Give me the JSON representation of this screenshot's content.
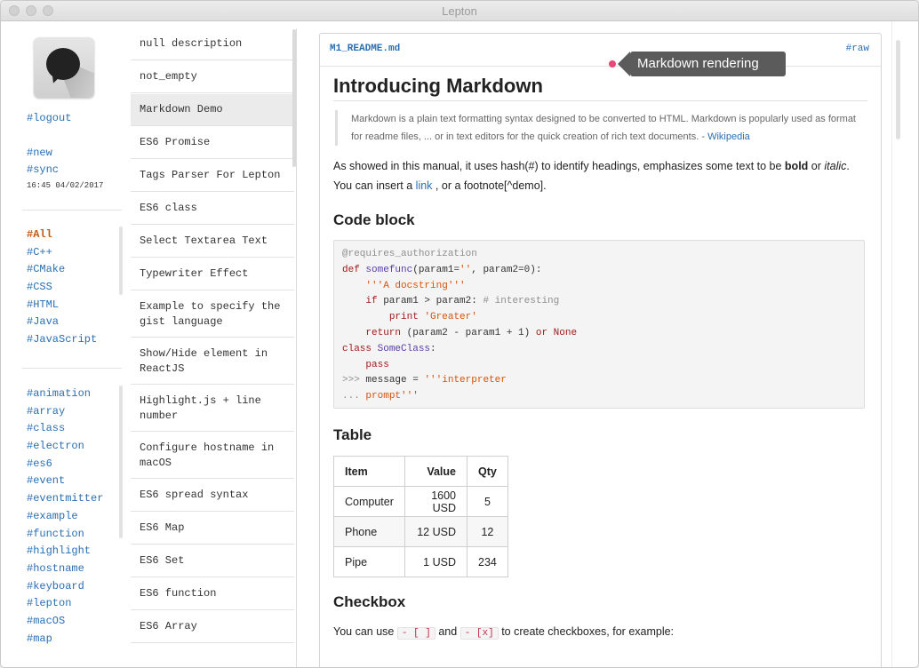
{
  "window": {
    "title": "Lepton"
  },
  "left": {
    "logout": "#logout",
    "new": "#new",
    "sync": "#sync",
    "sync_time": "16:45 04/02/2017",
    "languages": [
      "#All",
      "#C++",
      "#CMake",
      "#CSS",
      "#HTML",
      "#Java",
      "#JavaScript"
    ],
    "active_tag": "#All",
    "tags": [
      "#animation",
      "#array",
      "#class",
      "#electron",
      "#es6",
      "#event",
      "#eventmitter",
      "#example",
      "#function",
      "#highlight",
      "#hostname",
      "#keyboard",
      "#lepton",
      "#macOS",
      "#map"
    ]
  },
  "notes": [
    "null description",
    "not_empty",
    "Markdown Demo",
    "ES6 Promise",
    "Tags Parser For Lepton",
    "ES6 class",
    "Select Textarea Text",
    "Typewriter Effect",
    "Example to specify the gist language",
    "Show/Hide element in ReactJS",
    "Highlight.js + line number",
    "Configure hostname in macOS",
    "ES6 spread syntax",
    "ES6 Map",
    "ES6 Set",
    "ES6 function",
    "ES6 Array"
  ],
  "selected_note": "Markdown Demo",
  "editor": {
    "filename": "M1_README.md",
    "raw_label": "#raw",
    "tooltip": "Markdown rendering",
    "h1": "Introducing Markdown",
    "quote_text": "Markdown is a plain text formatting syntax designed to be converted to HTML. Markdown is popularly used as format for readme files, ... or in text editors for the quick creation of rich text documents. -",
    "quote_link": "Wikipedia",
    "para1_a": "As showed in this manual, it uses hash(#) to identify headings, emphasizes some text to be",
    "para1_bold": "bold",
    "para1_or": "or",
    "para1_italic": "italic",
    "para1_b": ". You can insert a",
    "para1_link": "link",
    "para1_c": ", or a footnote[^demo].",
    "h2_code": "Code block",
    "h2_table": "Table",
    "table": {
      "headers": [
        "Item",
        "Value",
        "Qty"
      ],
      "rows": [
        [
          "Computer",
          "1600 USD",
          "5"
        ],
        [
          "Phone",
          "12 USD",
          "12"
        ],
        [
          "Pipe",
          "1 USD",
          "234"
        ]
      ]
    },
    "h2_checkbox": "Checkbox",
    "cb_text_a": "You can use",
    "cb_code1": "- [ ]",
    "cb_and": "and",
    "cb_code2": "- [x]",
    "cb_text_b": "to create checkboxes, for example:"
  },
  "colors": {
    "link": "#2a6fb3",
    "active_tag": "#c35a12",
    "tooltip_bg": "#5b5b5b",
    "tooltip_dot": "#e84677"
  }
}
